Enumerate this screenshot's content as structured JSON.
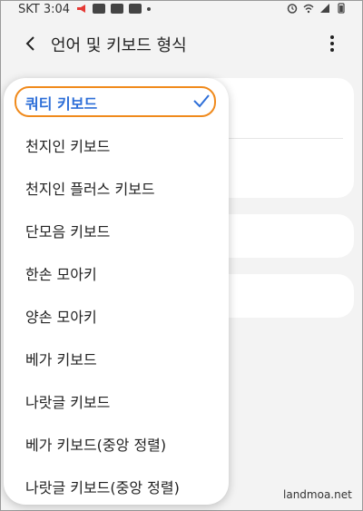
{
  "status_bar": {
    "carrier_time": "SKT 3:04"
  },
  "app_bar": {
    "title": "언어 및 키보드 형식"
  },
  "keyboard_menu": {
    "items": [
      {
        "label": "쿼티 키보드",
        "selected": true
      },
      {
        "label": "천지인 키보드"
      },
      {
        "label": "천지인 플러스 키보드"
      },
      {
        "label": "단모음 키보드"
      },
      {
        "label": "한손 모아키"
      },
      {
        "label": "양손 모아키"
      },
      {
        "label": "베가 키보드"
      },
      {
        "label": "나랏글 키보드"
      },
      {
        "label": "베가 키보드(중앙 정렬)"
      },
      {
        "label": "나랏글 키보드(중앙 정렬)"
      }
    ]
  },
  "watermark": "landmoa.net",
  "colors": {
    "accent": "#2e6fd8",
    "highlight_ring": "#f08a1c",
    "notification_icon": "#e53935"
  }
}
